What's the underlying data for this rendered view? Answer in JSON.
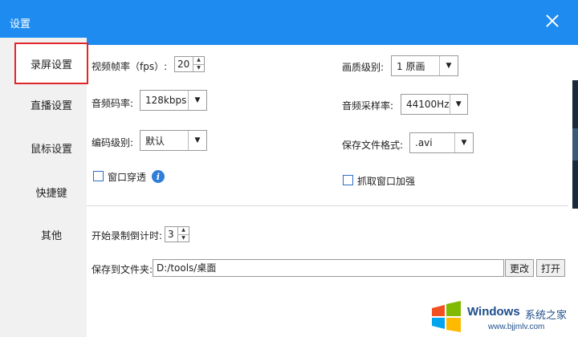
{
  "window": {
    "title": "设置"
  },
  "sidebar": {
    "items": [
      {
        "label": "录屏设置",
        "active": true
      },
      {
        "label": "直播设置",
        "active": false
      },
      {
        "label": "鼠标设置",
        "active": false
      },
      {
        "label": "快捷键",
        "active": false
      },
      {
        "label": "其他",
        "active": false
      }
    ]
  },
  "settings": {
    "fps": {
      "label": "视频帧率（fps）:",
      "value": "20"
    },
    "audio_bitrate": {
      "label": "音频码率:",
      "value": "128kbps"
    },
    "encode_level": {
      "label": "编码级别:",
      "value": "默认"
    },
    "window_passthrough": {
      "label": "窗口穿透",
      "checked": false,
      "info_icon": "i"
    },
    "quality_level": {
      "label": "画质级别:",
      "value": "1 原画"
    },
    "sample_rate": {
      "label": "音频采样率:",
      "value": "44100Hz"
    },
    "file_format": {
      "label": "保存文件格式:",
      "value": ".avi"
    },
    "capture_enhance": {
      "label": "抓取窗口加强",
      "checked": false
    },
    "countdown": {
      "label": "开始录制倒计时:",
      "value": "3"
    },
    "save_folder": {
      "label": "保存到文件夹:",
      "value": "D:/tools/桌面"
    }
  },
  "buttons": {
    "change": "更改",
    "open": "打开"
  },
  "watermark": {
    "brand": "Windows",
    "cn": "系统之家",
    "url": "www.bjjmlv.com"
  },
  "colors": {
    "titlebar": "#1e8bf0",
    "active_border": "#e0262a",
    "sidebar_bg": "#f1f1f1"
  }
}
